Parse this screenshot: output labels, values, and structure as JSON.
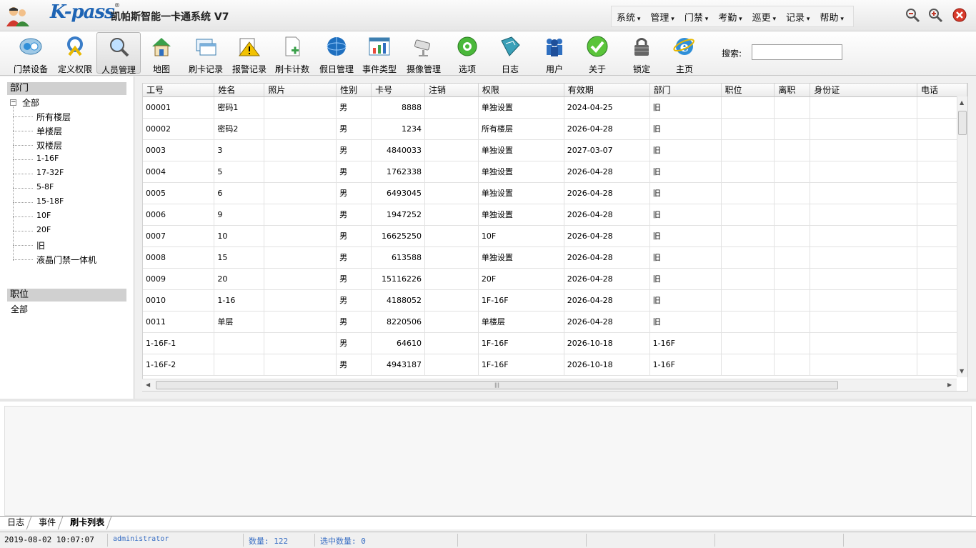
{
  "app": {
    "brand": "K-pass",
    "brand_mark": "®",
    "title": "凯帕斯智能一卡通系统  V7"
  },
  "menu": [
    "系统",
    "管理",
    "门禁",
    "考勤",
    "巡更",
    "记录",
    "帮助"
  ],
  "toolbar": {
    "items": [
      {
        "label": "门禁设备",
        "icon": "door-device-icon"
      },
      {
        "label": "定义权限",
        "icon": "define-permission-icon"
      },
      {
        "label": "人员管理",
        "icon": "personnel-search-icon",
        "active": true
      },
      {
        "label": "地图",
        "icon": "map-house-icon"
      },
      {
        "label": "刷卡记录",
        "icon": "card-record-icon"
      },
      {
        "label": "报警记录",
        "icon": "alarm-warning-icon"
      },
      {
        "label": "刷卡计数",
        "icon": "card-count-icon"
      },
      {
        "label": "假日管理",
        "icon": "holiday-globe-icon"
      },
      {
        "label": "事件类型",
        "icon": "event-chart-icon"
      },
      {
        "label": "摄像管理",
        "icon": "camera-icon"
      },
      {
        "label": "选项",
        "icon": "options-gear-icon"
      },
      {
        "label": "日志",
        "icon": "log-book-icon"
      },
      {
        "label": "用户",
        "icon": "users-group-icon"
      },
      {
        "label": "关于",
        "icon": "about-check-icon"
      },
      {
        "label": "锁定",
        "icon": "lock-icon"
      },
      {
        "label": "主页",
        "icon": "home-ie-icon"
      }
    ],
    "search_label": "搜索:",
    "search_value": ""
  },
  "departments": {
    "header": "部门",
    "root": "全部",
    "items": [
      "所有楼层",
      "单楼层",
      "双楼层",
      "1-16F",
      "17-32F",
      "5-8F",
      "15-18F",
      "10F",
      "20F",
      "旧",
      "液晶门禁一体机"
    ]
  },
  "positions": {
    "header": "职位",
    "items": [
      "全部"
    ]
  },
  "table": {
    "columns": [
      "工号",
      "姓名",
      "照片",
      "性别",
      "卡号",
      "注销",
      "权限",
      "有效期",
      "部门",
      "职位",
      "离职",
      "身份证",
      "电话"
    ],
    "rows": [
      [
        "00001",
        "密码1",
        "",
        "男",
        "8888",
        "",
        "单独设置",
        "2024-04-25",
        "旧",
        "",
        "",
        "",
        ""
      ],
      [
        "00002",
        "密码2",
        "",
        "男",
        "1234",
        "",
        "所有楼层",
        "2026-04-28",
        "旧",
        "",
        "",
        "",
        ""
      ],
      [
        "0003",
        "3",
        "",
        "男",
        "4840033",
        "",
        "单独设置",
        "2027-03-07",
        "旧",
        "",
        "",
        "",
        ""
      ],
      [
        "0004",
        "5",
        "",
        "男",
        "1762338",
        "",
        "单独设置",
        "2026-04-28",
        "旧",
        "",
        "",
        "",
        ""
      ],
      [
        "0005",
        "6",
        "",
        "男",
        "6493045",
        "",
        "单独设置",
        "2026-04-28",
        "旧",
        "",
        "",
        "",
        ""
      ],
      [
        "0006",
        "9",
        "",
        "男",
        "1947252",
        "",
        "单独设置",
        "2026-04-28",
        "旧",
        "",
        "",
        "",
        ""
      ],
      [
        "0007",
        "10",
        "",
        "男",
        "16625250",
        "",
        "10F",
        "2026-04-28",
        "旧",
        "",
        "",
        "",
        ""
      ],
      [
        "0008",
        "15",
        "",
        "男",
        "613588",
        "",
        "单独设置",
        "2026-04-28",
        "旧",
        "",
        "",
        "",
        ""
      ],
      [
        "0009",
        "20",
        "",
        "男",
        "15116226",
        "",
        "20F",
        "2026-04-28",
        "旧",
        "",
        "",
        "",
        ""
      ],
      [
        "0010",
        "1-16",
        "",
        "男",
        "4188052",
        "",
        "1F-16F",
        "2026-04-28",
        "旧",
        "",
        "",
        "",
        ""
      ],
      [
        "0011",
        "单层",
        "",
        "男",
        "8220506",
        "",
        "单楼层",
        "2026-04-28",
        "旧",
        "",
        "",
        "",
        ""
      ],
      [
        "1-16F-1",
        "",
        "",
        "男",
        "64610",
        "",
        "1F-16F",
        "2026-10-18",
        "1-16F",
        "",
        "",
        "",
        ""
      ],
      [
        "1-16F-2",
        "",
        "",
        "男",
        "4943187",
        "",
        "1F-16F",
        "2026-10-18",
        "1-16F",
        "",
        "",
        "",
        ""
      ]
    ]
  },
  "bottom_tabs": [
    "日志",
    "事件",
    "刷卡列表"
  ],
  "status": {
    "datetime": "2019-08-02 10:07:07",
    "user": "administrator",
    "count": "数量: 122",
    "selected": "选中数量: 0"
  },
  "colors": {
    "accent": "#1e64b4",
    "status_text": "#3a6fc4"
  }
}
